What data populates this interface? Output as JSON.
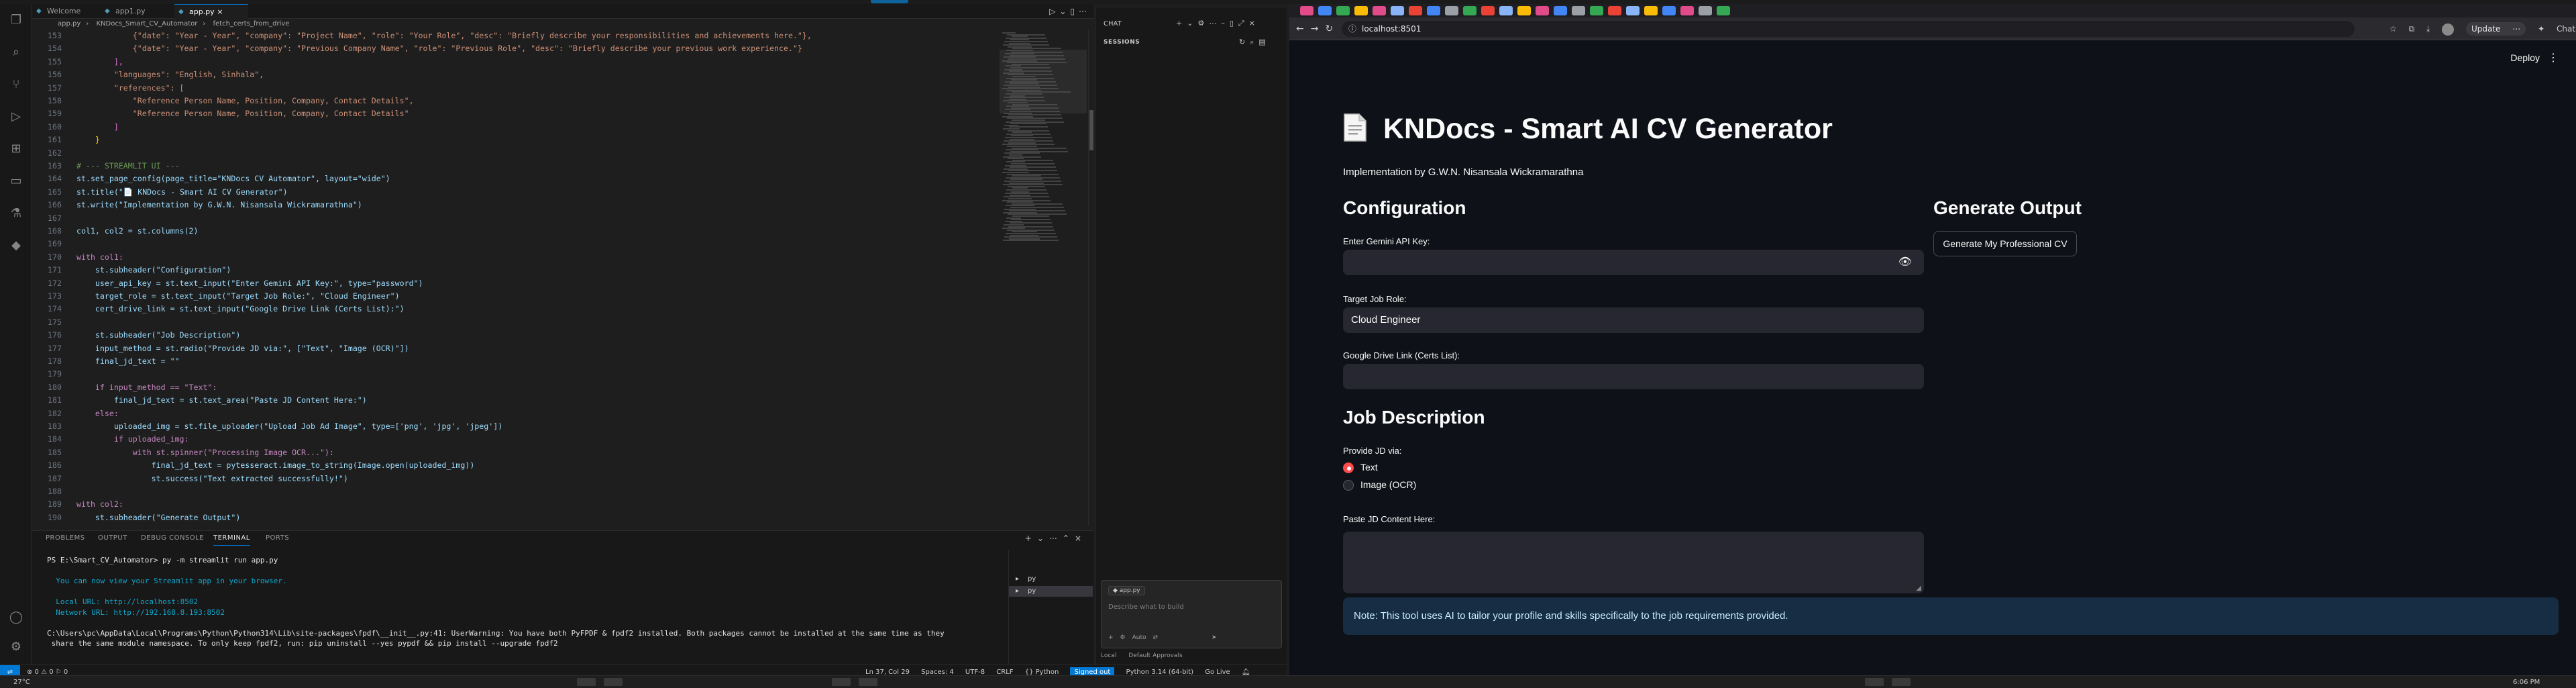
{
  "vscode": {
    "tabs": [
      {
        "label": "Welcome",
        "active": false
      },
      {
        "label": "app1.py",
        "active": false
      },
      {
        "label": "app.py",
        "active": true
      }
    ],
    "breadcrumbs": [
      "app.py",
      "KNDocs_Smart_CV_Automator",
      "fetch_certs_from_drive"
    ],
    "code_lines": [
      {
        "n": "153",
        "t": "            {\"date\": \"Year - Year\", \"company\": \"Project Name\", \"role\": \"Your Role\", \"desc\": \"Briefly describe your responsibilities and achievements here.\"},",
        "c": "c-str"
      },
      {
        "n": "154",
        "t": "            {\"date\": \"Year - Year\", \"company\": \"Previous Company Name\", \"role\": \"Previous Role\", \"desc\": \"Briefly describe your previous work experience.\"}",
        "c": "c-str"
      },
      {
        "n": "155",
        "t": "        ],",
        "c": "c-br2"
      },
      {
        "n": "156",
        "t": "        \"languages\": \"English, Sinhala\",",
        "c": "c-str"
      },
      {
        "n": "157",
        "t": "        \"references\": [",
        "c": "c-str"
      },
      {
        "n": "158",
        "t": "            \"Reference Person Name, Position, Company, Contact Details\",",
        "c": "c-str"
      },
      {
        "n": "159",
        "t": "            \"Reference Person Name, Position, Company, Contact Details\"",
        "c": "c-str"
      },
      {
        "n": "160",
        "t": "        ]",
        "c": "c-br2"
      },
      {
        "n": "161",
        "t": "    }",
        "c": "c-br"
      },
      {
        "n": "162",
        "t": "",
        "c": ""
      },
      {
        "n": "163",
        "t": "# --- STREAMLIT UI ---",
        "c": "c-cm"
      },
      {
        "n": "164",
        "t": "st.set_page_config(page_title=\"KNDocs CV Automator\", layout=\"wide\")",
        "c": "c-var"
      },
      {
        "n": "165",
        "t": "st.title(\"📄 KNDocs - Smart AI CV Generator\")",
        "c": "c-var"
      },
      {
        "n": "166",
        "t": "st.write(\"Implementation by G.W.N. Nisansala Wickramarathna\")",
        "c": "c-var"
      },
      {
        "n": "167",
        "t": "",
        "c": ""
      },
      {
        "n": "168",
        "t": "col1, col2 = st.columns(2)",
        "c": "c-var"
      },
      {
        "n": "169",
        "t": "",
        "c": ""
      },
      {
        "n": "170",
        "t": "with col1:",
        "c": "c-kw"
      },
      {
        "n": "171",
        "t": "    st.subheader(\"Configuration\")",
        "c": "c-var"
      },
      {
        "n": "172",
        "t": "    user_api_key = st.text_input(\"Enter Gemini API Key:\", type=\"password\")",
        "c": "c-var"
      },
      {
        "n": "173",
        "t": "    target_role = st.text_input(\"Target Job Role:\", \"Cloud Engineer\")",
        "c": "c-var"
      },
      {
        "n": "174",
        "t": "    cert_drive_link = st.text_input(\"Google Drive Link (Certs List):\")",
        "c": "c-var"
      },
      {
        "n": "175",
        "t": "",
        "c": ""
      },
      {
        "n": "176",
        "t": "    st.subheader(\"Job Description\")",
        "c": "c-var"
      },
      {
        "n": "177",
        "t": "    input_method = st.radio(\"Provide JD via:\", [\"Text\", \"Image (OCR)\"])",
        "c": "c-var"
      },
      {
        "n": "178",
        "t": "    final_jd_text = \"\"",
        "c": "c-var"
      },
      {
        "n": "179",
        "t": "",
        "c": ""
      },
      {
        "n": "180",
        "t": "    if input_method == \"Text\":",
        "c": "c-kw"
      },
      {
        "n": "181",
        "t": "        final_jd_text = st.text_area(\"Paste JD Content Here:\")",
        "c": "c-var"
      },
      {
        "n": "182",
        "t": "    else:",
        "c": "c-kw"
      },
      {
        "n": "183",
        "t": "        uploaded_img = st.file_uploader(\"Upload Job Ad Image\", type=['png', 'jpg', 'jpeg'])",
        "c": "c-var"
      },
      {
        "n": "184",
        "t": "        if uploaded_img:",
        "c": "c-kw"
      },
      {
        "n": "185",
        "t": "            with st.spinner(\"Processing Image OCR...\"):",
        "c": "c-kw"
      },
      {
        "n": "186",
        "t": "                final_jd_text = pytesseract.image_to_string(Image.open(uploaded_img))",
        "c": "c-var"
      },
      {
        "n": "187",
        "t": "                st.success(\"Text extracted successfully!\")",
        "c": "c-var"
      },
      {
        "n": "188",
        "t": "",
        "c": ""
      },
      {
        "n": "189",
        "t": "with col2:",
        "c": "c-kw"
      },
      {
        "n": "190",
        "t": "    st.subheader(\"Generate Output\")",
        "c": "c-var"
      }
    ],
    "panel_tabs": [
      {
        "label": "PROBLEMS",
        "active": false
      },
      {
        "label": "OUTPUT",
        "active": false
      },
      {
        "label": "DEBUG CONSOLE",
        "active": false
      },
      {
        "label": "TERMINAL",
        "active": true
      },
      {
        "label": "PORTS",
        "active": false
      }
    ],
    "terminal_lines": [
      {
        "t": "PS E:\\Smart_CV_Automator> py -m streamlit run app.py",
        "c": "t-white"
      },
      {
        "t": "",
        "c": ""
      },
      {
        "t": "  You can now view your Streamlit app in your browser.",
        "c": "t-cyan"
      },
      {
        "t": "",
        "c": ""
      },
      {
        "t": "  Local URL: http://localhost:8502",
        "c": "t-cyan"
      },
      {
        "t": "  Network URL: http://192.168.8.193:8502",
        "c": "t-cyan"
      },
      {
        "t": "",
        "c": ""
      },
      {
        "t": "C:\\Users\\pc\\AppData\\Local\\Programs\\Python\\Python314\\Lib\\site-packages\\fpdf\\__init__.py:41: UserWarning: You have both PyFPDF & fpdf2 installed. Both packages cannot be installed at the same time as they",
        "c": "t-white"
      },
      {
        "t": " share the same module namespace. To only keep fpdf2, run: pip uninstall --yes pypdf && pip install --upgrade fpdf2",
        "c": "t-white"
      }
    ],
    "terminal_list": [
      "py",
      "py"
    ],
    "status_left": "⊗ 0 ⚠ 0   ⚐ 0",
    "status_right": [
      "Ln 37, Col 29",
      "Spaces: 4",
      "UTF-8",
      "CRLF",
      "{} Python",
      "Signed out",
      "Python 3.14 (64-bit)",
      "Go Live"
    ]
  },
  "chat": {
    "title": "CHAT",
    "sessions_label": "SESSIONS",
    "attached_file": "app.py",
    "placeholder": "Describe what to build",
    "tools": [
      "Auto"
    ],
    "footer": [
      "Local",
      "Default Approvals"
    ]
  },
  "browser": {
    "url": "localhost:8501",
    "update_label": "Update",
    "chat_label": "Chat",
    "tab_colors": [
      "#e24b8a",
      "#4285f4",
      "#34a853",
      "#fbbc05",
      "#e24b8a",
      "#8ab4f8",
      "#ea4335",
      "#4285f4",
      "#9aa0a6",
      "#34a853",
      "#ea4335",
      "#8ab4f8",
      "#fbbc05",
      "#e24b8a",
      "#4285f4",
      "#9aa0a6",
      "#34a853",
      "#ea4335",
      "#8ab4f8",
      "#fbbc05",
      "#4285f4",
      "#e24b8a",
      "#9aa0a6",
      "#34a853"
    ]
  },
  "streamlit": {
    "deploy_label": "Deploy",
    "title": "KNDocs - Smart AI CV Generator",
    "subtitle": "Implementation by G.W.N. Nisansala Wickramarathna",
    "config_header": "Configuration",
    "api_key_label": "Enter Gemini API Key:",
    "api_key_value": "",
    "role_label": "Target Job Role:",
    "role_value": "Cloud Engineer",
    "drive_label": "Google Drive Link (Certs List):",
    "drive_value": "",
    "jd_header": "Job Description",
    "jd_via_label": "Provide JD via:",
    "jd_options": [
      {
        "label": "Text",
        "selected": true
      },
      {
        "label": "Image (OCR)",
        "selected": false
      }
    ],
    "jd_text_label": "Paste JD Content Here:",
    "output_header": "Generate Output",
    "generate_button": "Generate My Professional CV",
    "note": "Note: This tool uses AI to tailor your profile and skills specifically to the job requirements provided.",
    "accent": "#ff4b4b"
  },
  "taskbar": {
    "weather": "27°C",
    "clock": "6:06 PM"
  }
}
